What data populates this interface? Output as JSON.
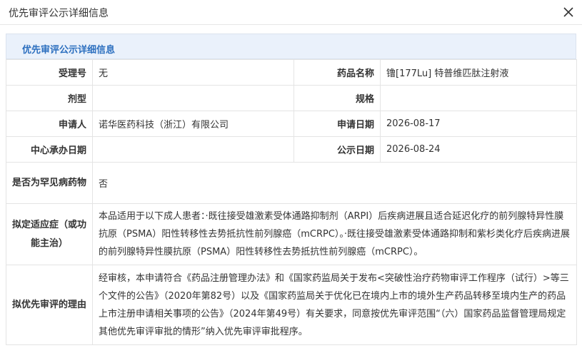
{
  "dialog": {
    "title": "优先审评公示详细信息"
  },
  "section": {
    "title": "优先审评公示详细信息"
  },
  "fields": {
    "acceptance_no": {
      "label": "受理号",
      "value": "无"
    },
    "drug_name": {
      "label": "药品名称",
      "value": "镥[177Lu] 特普维匹肽注射液"
    },
    "dosage_form": {
      "label": "剂型",
      "value": ""
    },
    "specification": {
      "label": "规格",
      "value": ""
    },
    "applicant": {
      "label": "申请人",
      "value": "诺华医药科技（浙江）有限公司"
    },
    "application_date": {
      "label": "申请日期",
      "value": "2026-08-17"
    },
    "center_date": {
      "label": "中心承办日期",
      "value": ""
    },
    "publicity_date": {
      "label": "公示日期",
      "value": "2026-08-24"
    },
    "rare_disease": {
      "label": "是否为罕见病药物",
      "value": "否"
    },
    "indication": {
      "label": "拟定适应症（或功能主治）",
      "value": "本品适用于以下成人患者：·既往接受雄激素受体通路抑制剂（ARPI）后疾病进展且适合延迟化疗的前列腺特异性膜抗原（PSMA）阳性转移性去势抵抗性前列腺癌（mCRPC）。·既往接受雄激素受体通路抑制和紫杉类化疗后疾病进展的前列腺特异性膜抗原（PSMA）阳性转移性去势抵抗性前列腺癌（mCRPC）。"
    },
    "priority_reason": {
      "label": "拟优先审评的理由",
      "value": "经审核，本申请符合《药品注册管理办法》和《国家药监局关于发布<突破性治疗药物审评工作程序（试行）>等三个文件的公告》（2020年第82号）以及《国家药监局关于优化已在境内上市的境外生产药品转移至境内生产的药品上市注册申请相关事项的公告》（2024年第49号）有关要求，同意按优先审评范围“（六）国家药品监督管理局规定其他优先审评审批的情形”纳入优先审评审批程序。"
    }
  },
  "icons": {
    "close": "close-icon"
  },
  "colors": {
    "section_bg": "#eaf1fb",
    "section_title": "#2c6fbf",
    "border": "#e4e4e4"
  }
}
